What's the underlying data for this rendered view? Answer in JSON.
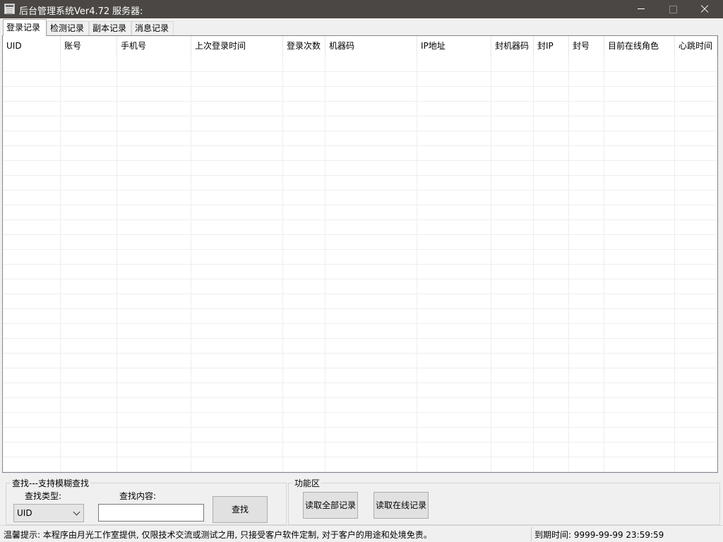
{
  "window": {
    "title": "后台管理系统Ver4.72",
    "server_label": "服务器:"
  },
  "tabs": [
    {
      "label": "登录记录",
      "active": true
    },
    {
      "label": "检测记录",
      "active": false
    },
    {
      "label": "副本记录",
      "active": false
    },
    {
      "label": "消息记录",
      "active": false
    }
  ],
  "table": {
    "columns": [
      "UID",
      "账号",
      "手机号",
      "上次登录时间",
      "登录次数",
      "机器码",
      "IP地址",
      "封机器码",
      "封IP",
      "封号",
      "目前在线角色",
      "心跳时间"
    ],
    "rows": []
  },
  "search": {
    "group_title": "查找---支持模糊查找",
    "type_label": "查找类型:",
    "type_value": "UID",
    "content_label": "查找内容:",
    "content_value": "",
    "button_label": "查找"
  },
  "functions": {
    "group_title": "功能区",
    "read_all_label": "读取全部记录",
    "read_online_label": "读取在线记录"
  },
  "status": {
    "notice": "温馨提示: 本程序由月光工作室提供, 仅限技术交流或测试之用, 只接受客户软件定制, 对于客户的用途和处境免责。",
    "expiry": "到期时间: 9999-99-99 23:59:59"
  }
}
